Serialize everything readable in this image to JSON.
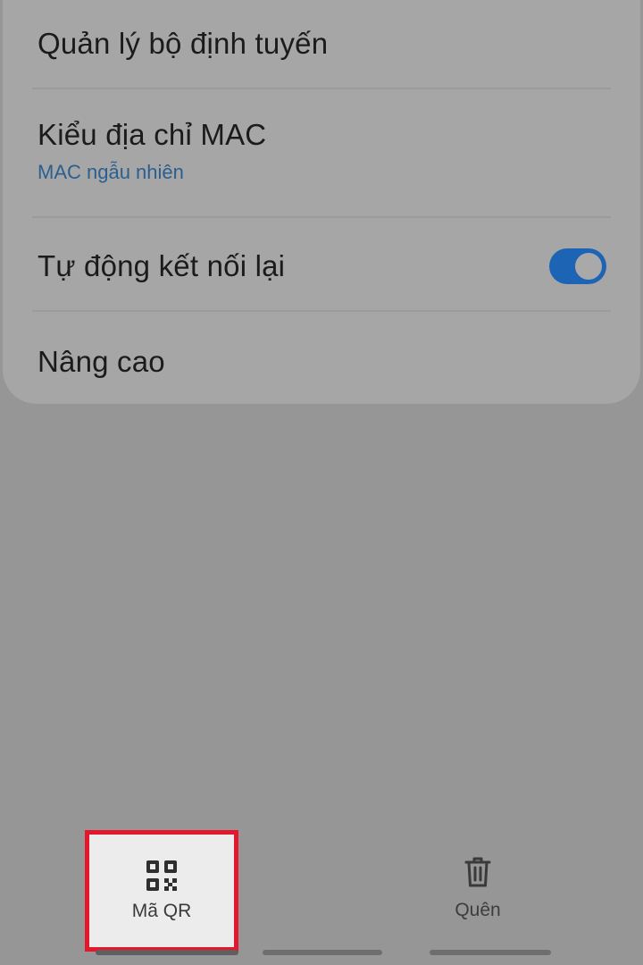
{
  "settings": {
    "router_manage_label": "Quản lý bộ định tuyến",
    "mac_type": {
      "label": "Kiểu địa chỉ MAC",
      "value": "MAC ngẫu nhiên"
    },
    "auto_reconnect": {
      "label": "Tự động kết nối lại",
      "enabled": true
    },
    "advanced_label": "Nâng cao"
  },
  "bottom_bar": {
    "qr_label": "Mã QR",
    "forget_label": "Quên"
  },
  "colors": {
    "accent": "#1d64b5",
    "highlight_border": "#e3182d"
  },
  "icons": {
    "qr": "qr-code-icon",
    "forget": "trash-icon"
  }
}
